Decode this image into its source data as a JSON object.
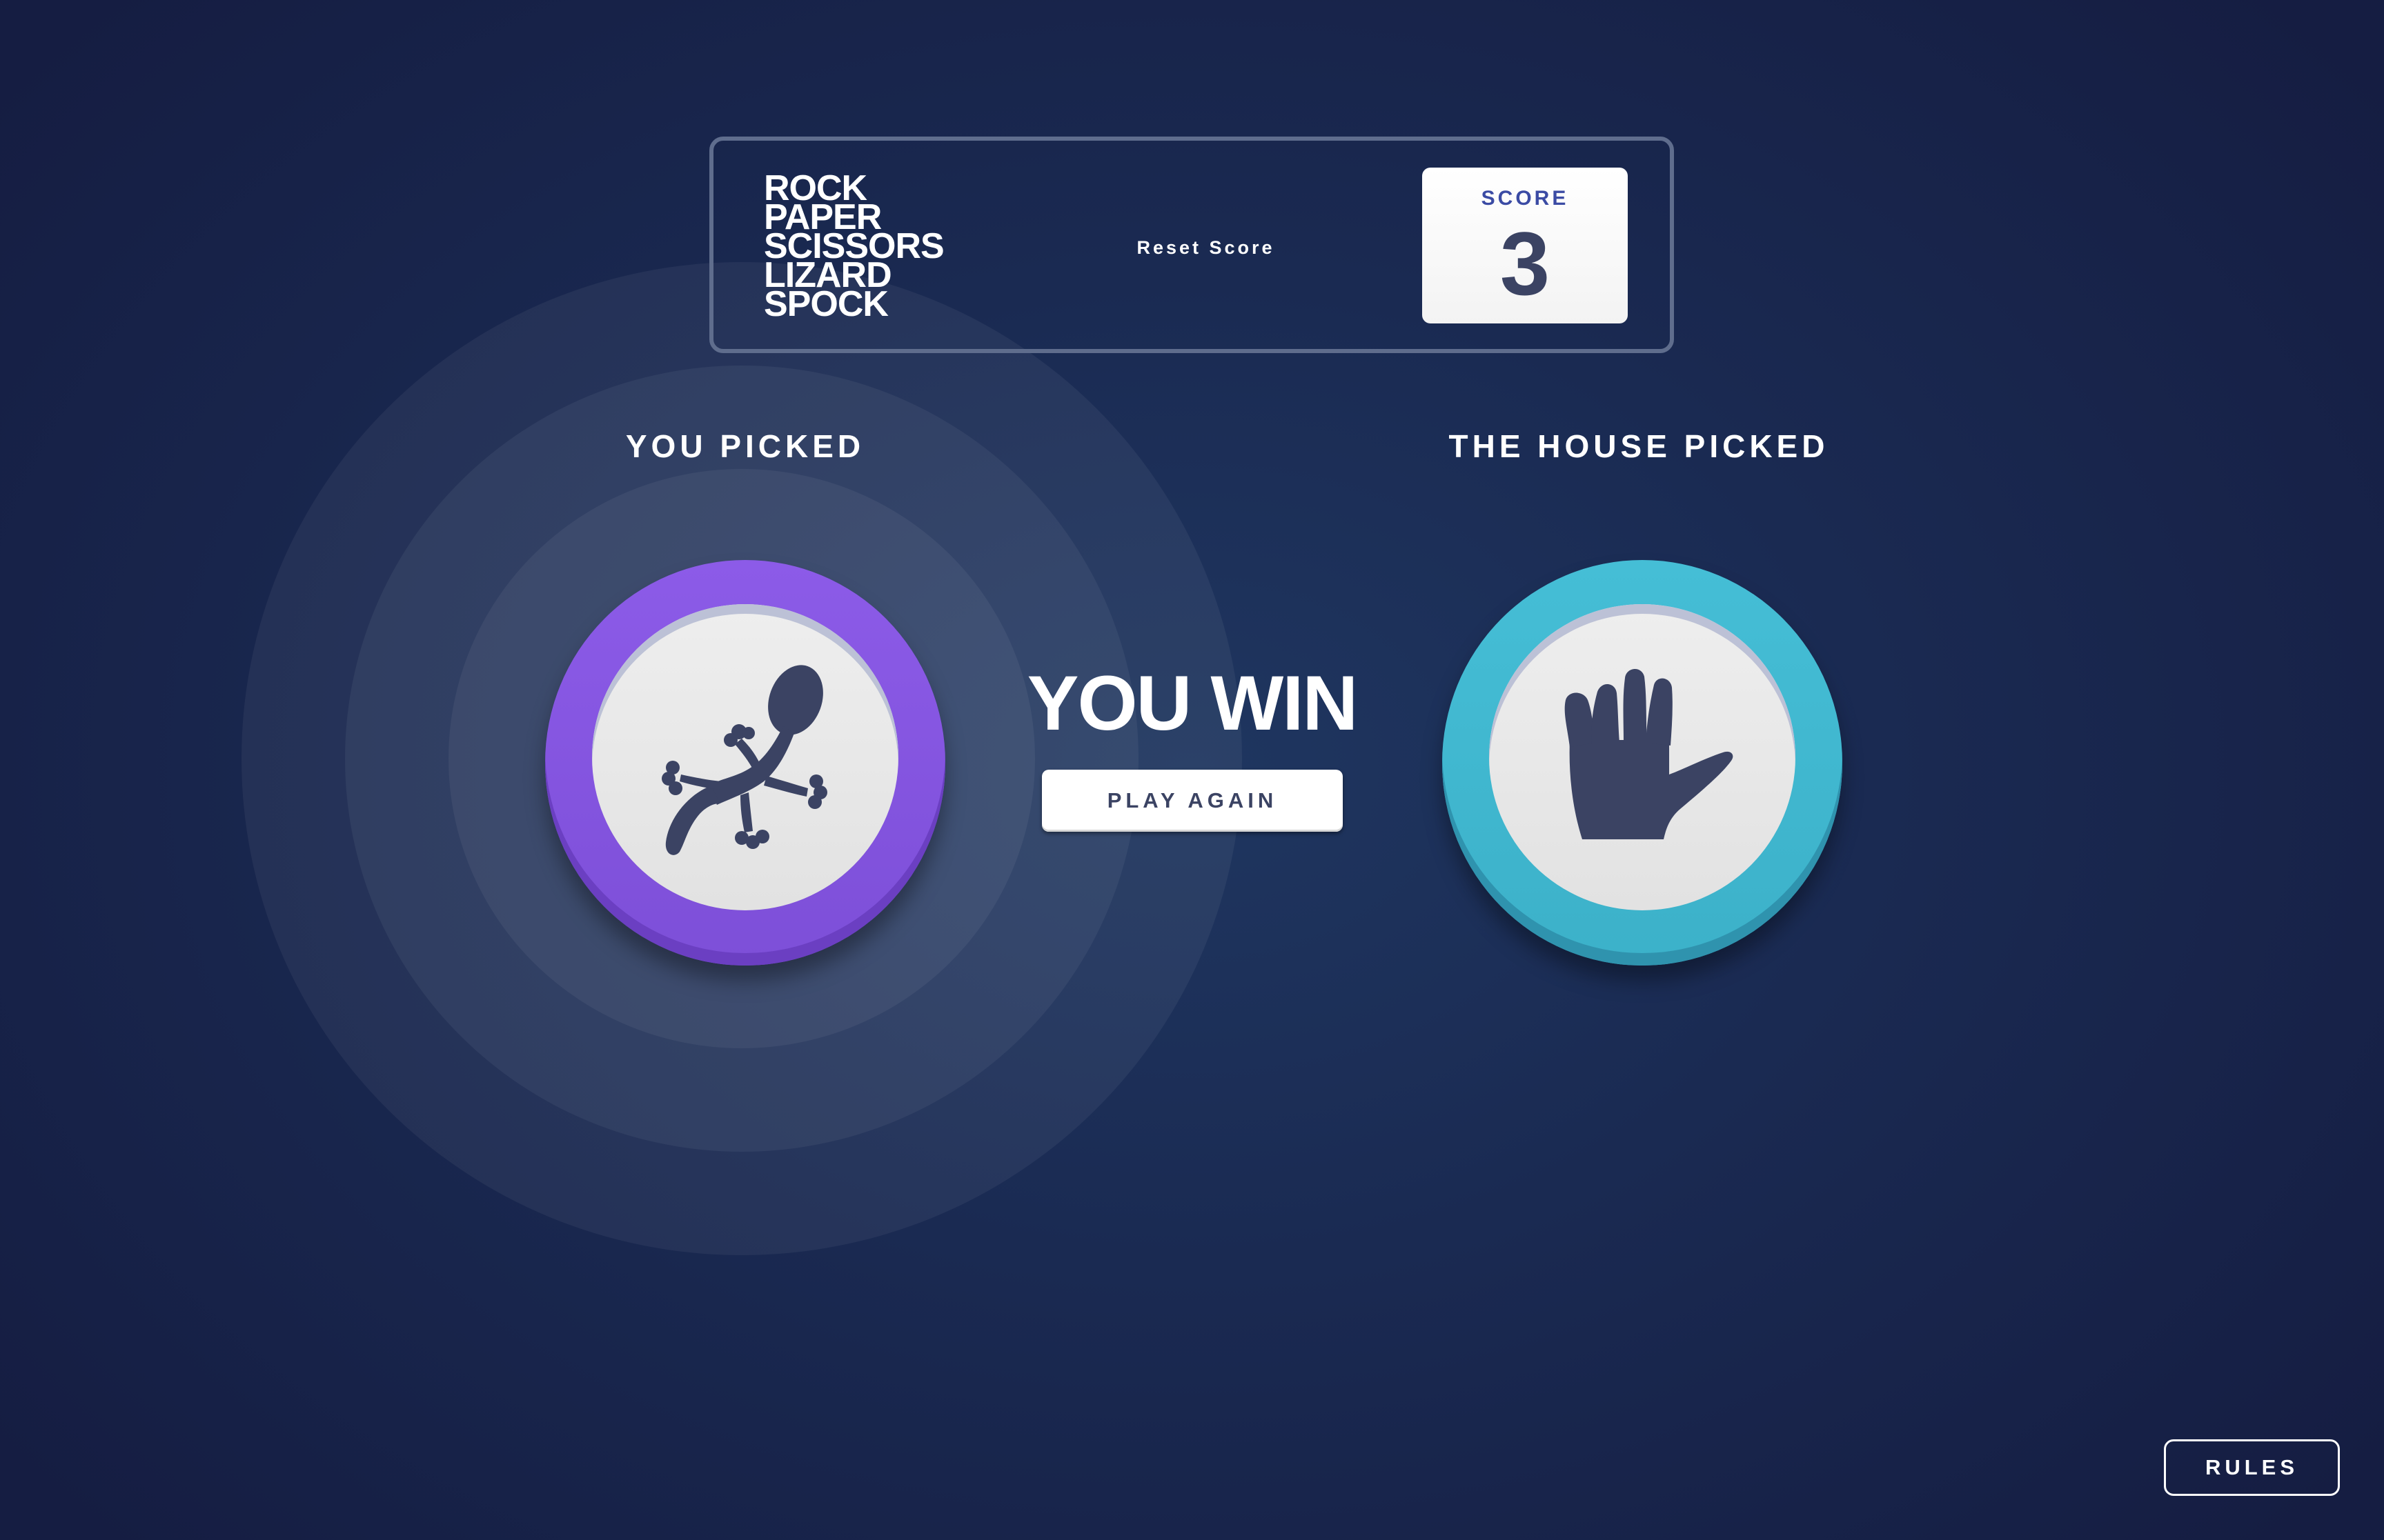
{
  "header": {
    "logo_lines": [
      "ROCK",
      "PAPER",
      "SCISSORS",
      "LIZARD",
      "SPOCK"
    ],
    "reset_label": "Reset Score",
    "score_label": "SCORE",
    "score_value": "3"
  },
  "game": {
    "player_title": "YOU PICKED",
    "house_title": "THE HOUSE PICKED",
    "player_pick": "lizard",
    "house_pick": "spock",
    "player_icon": "lizard-icon",
    "house_icon": "spock-hand-icon",
    "result": "YOU WIN",
    "play_again_label": "PLAY AGAIN"
  },
  "colors": {
    "lizard": "#8c5be8",
    "spock": "#45bed6",
    "score_label": "#3b4ba4",
    "dark_text": "#3b4363"
  },
  "footer": {
    "rules_label": "RULES"
  }
}
